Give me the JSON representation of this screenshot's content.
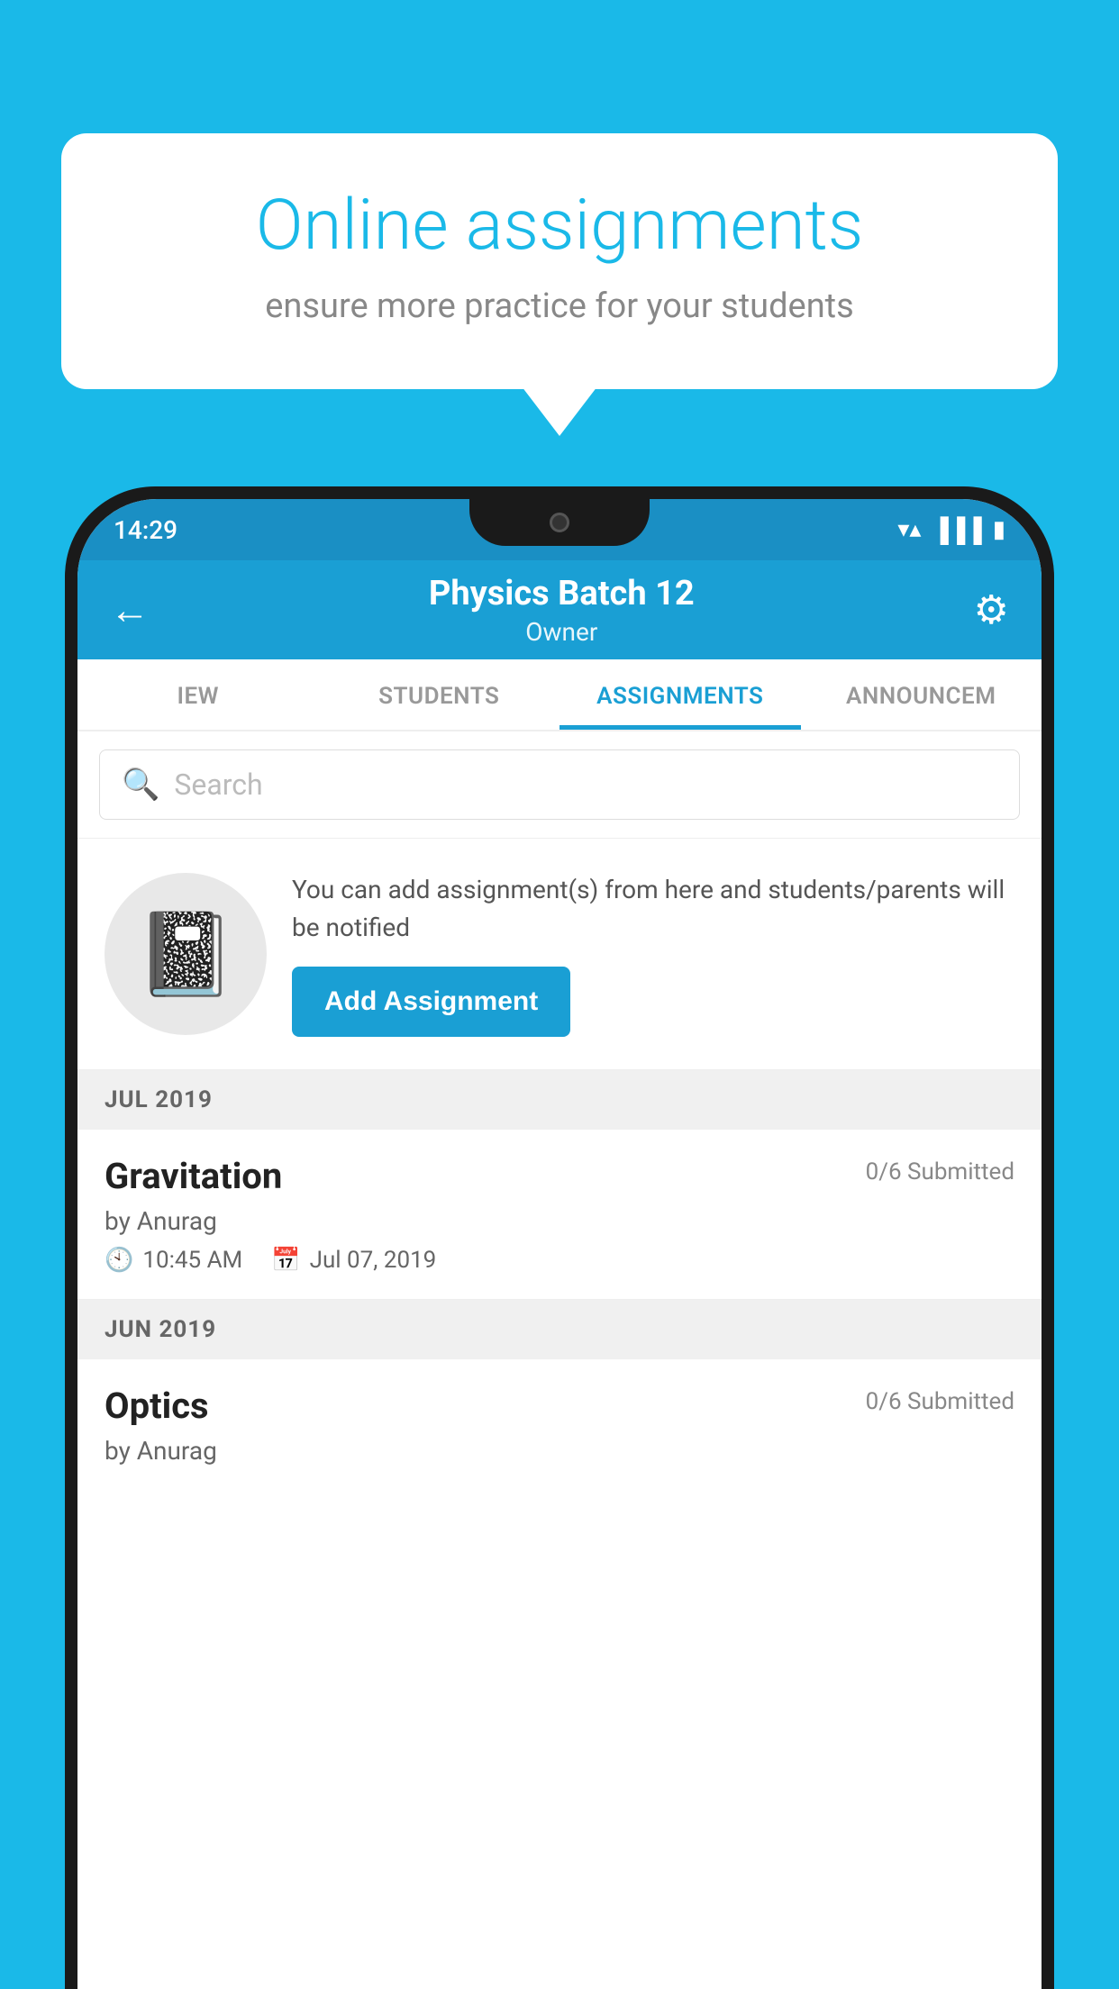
{
  "background": {
    "color": "#1ab9e8"
  },
  "speech_bubble": {
    "title": "Online assignments",
    "subtitle": "ensure more practice for your students"
  },
  "status_bar": {
    "time": "14:29",
    "icons": [
      "wifi",
      "signal",
      "battery"
    ]
  },
  "app_header": {
    "title": "Physics Batch 12",
    "subtitle": "Owner",
    "back_label": "←",
    "gear_label": "⚙"
  },
  "tabs": [
    {
      "label": "IEW",
      "active": false
    },
    {
      "label": "STUDENTS",
      "active": false
    },
    {
      "label": "ASSIGNMENTS",
      "active": true
    },
    {
      "label": "ANNOUNCEM",
      "active": false
    }
  ],
  "search": {
    "placeholder": "Search"
  },
  "promo": {
    "description": "You can add assignment(s) from here and students/parents will be notified",
    "button_label": "Add Assignment"
  },
  "sections": [
    {
      "header": "JUL 2019",
      "assignments": [
        {
          "title": "Gravitation",
          "submitted": "0/6 Submitted",
          "by": "by Anurag",
          "time": "10:45 AM",
          "date": "Jul 07, 2019"
        }
      ]
    },
    {
      "header": "JUN 2019",
      "assignments": [
        {
          "title": "Optics",
          "submitted": "0/6 Submitted",
          "by": "by Anurag"
        }
      ]
    }
  ]
}
